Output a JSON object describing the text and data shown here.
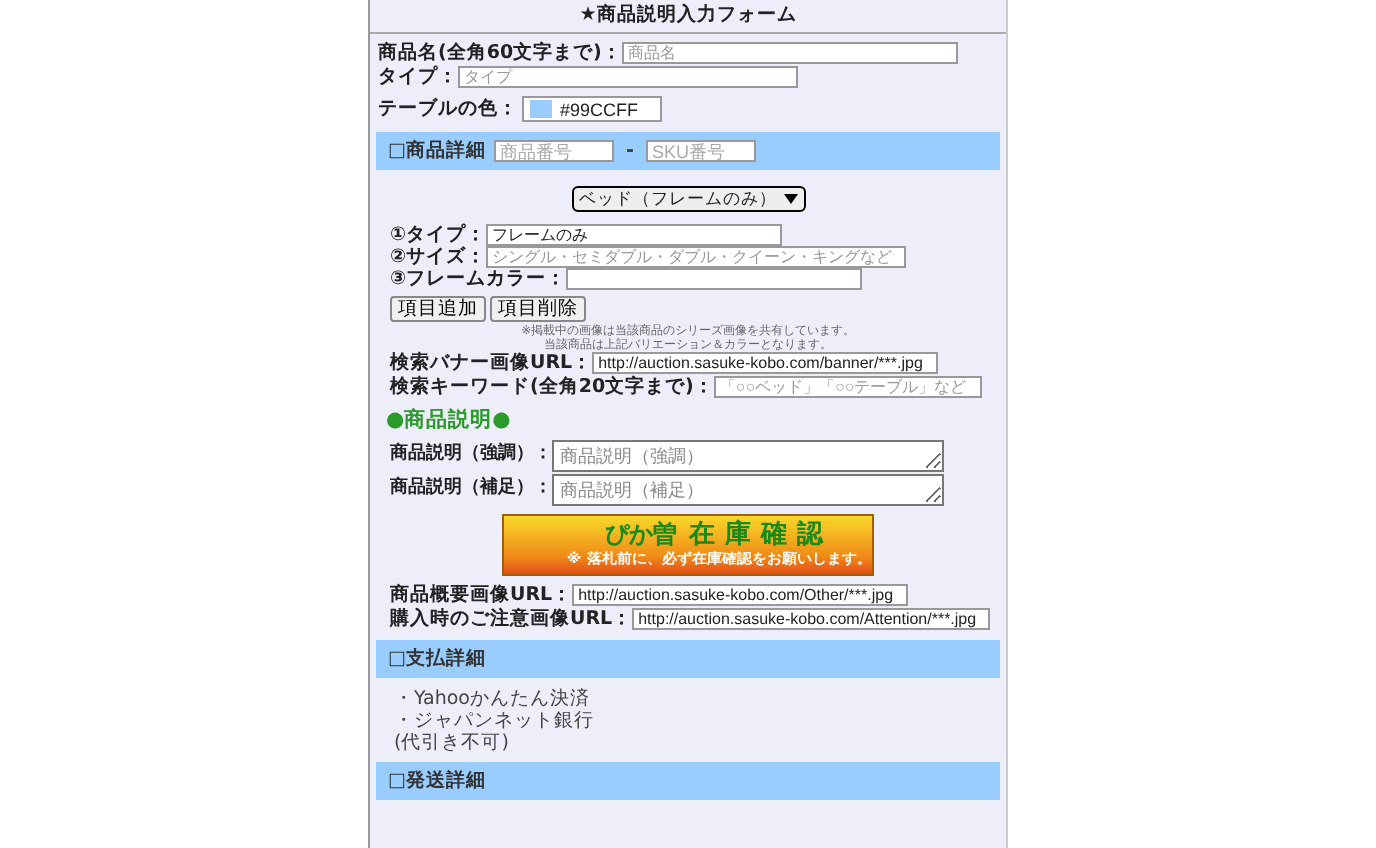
{
  "title": "★商品説明入力フォーム",
  "fields": [
    {
      "label": "商品名(全角60文字まで)：",
      "placeholder": "商品名"
    },
    {
      "label": "タイプ：",
      "placeholder": "タイプ"
    }
  ],
  "table_color": {
    "label": "テーブルの色：",
    "value": "#99CCFF"
  },
  "detail_section": {
    "title": "□商品詳細",
    "product_number": {
      "placeholder": "商品番号"
    },
    "separator": "-",
    "sku": {
      "placeholder": "SKU番号"
    }
  },
  "category_select": {
    "value": "ベッド（フレームのみ）"
  },
  "items": [
    {
      "label": "①タイプ：",
      "value": "フレームのみ"
    },
    {
      "label": "②サイズ：",
      "placeholder": "シングル・セミダブル・ダブル・クイーン・キングなど"
    },
    {
      "label": "③フレームカラー："
    }
  ],
  "buttons": [
    "項目追加",
    "項目削除"
  ],
  "notes": [
    "※掲載中の画像は当該商品のシリーズ画像を共有しています。",
    "当該商品は上記バリエーション＆カラーとなります。"
  ],
  "search_fields": [
    {
      "label": "検索バナー画像URL：",
      "value": "http://auction.sasuke-kobo.com/banner/***.jpg"
    },
    {
      "label": "検索キーワード(全角20文字まで)：",
      "placeholder": "「○○ベッド」「○○テーブル」など"
    }
  ],
  "description_heading": "●商品説明●",
  "descriptions": [
    {
      "label": "商品説明（強調）：",
      "placeholder": "商品説明（強調）"
    },
    {
      "label": "商品説明（補足）：",
      "placeholder": "商品説明（補足）"
    }
  ],
  "stock_banner": {
    "brand": "ぴか曽",
    "title": "在庫確認",
    "note": "※ 落札前に、必ず在庫確認をお願いします。"
  },
  "image_urls": [
    {
      "label": "商品概要画像URL：",
      "value": "http://auction.sasuke-kobo.com/Other/***.jpg"
    },
    {
      "label": "購入時のご注意画像URL：",
      "value": "http://auction.sasuke-kobo.com/Attention/***.jpg"
    }
  ],
  "payment_section": {
    "title": "□支払詳細",
    "lines": [
      "・Yahooかんたん決済",
      "・ジャパンネット銀行",
      "(代引き不可)"
    ]
  },
  "shipping_section": {
    "title": "□発送詳細"
  }
}
